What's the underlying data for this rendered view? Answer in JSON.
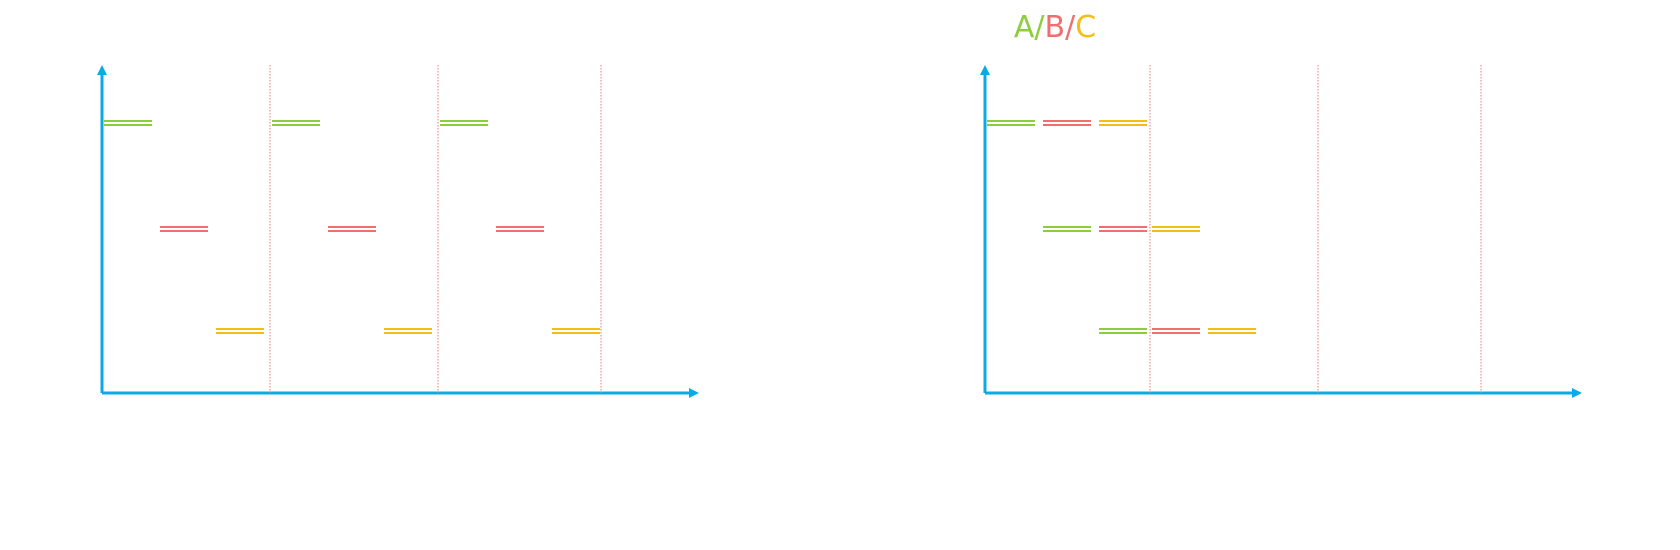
{
  "colors": {
    "axis": "#0AAAE6",
    "divider": "#F07878",
    "A": "#8CCD3C",
    "B": "#F06E6E",
    "C": "#F5BE14",
    "background": "#FFFFFF"
  },
  "legend": {
    "parts": [
      {
        "text": "A",
        "color_key": "A"
      },
      {
        "text": "/",
        "color_key": "A"
      },
      {
        "text": "B",
        "color_key": "B"
      },
      {
        "text": "/",
        "color_key": "B"
      },
      {
        "text": "C",
        "color_key": "C"
      }
    ]
  },
  "diagrams": [
    {
      "id": "sequential",
      "rows": [
        "A",
        "B",
        "C"
      ],
      "periods": 3,
      "slots_per_period": 3,
      "segments": [
        {
          "row": 0,
          "period": 0,
          "slot": 0,
          "color_key": "A"
        },
        {
          "row": 1,
          "period": 0,
          "slot": 1,
          "color_key": "B"
        },
        {
          "row": 2,
          "period": 0,
          "slot": 2,
          "color_key": "C"
        },
        {
          "row": 0,
          "period": 1,
          "slot": 0,
          "color_key": "A"
        },
        {
          "row": 1,
          "period": 1,
          "slot": 1,
          "color_key": "B"
        },
        {
          "row": 2,
          "period": 1,
          "slot": 2,
          "color_key": "C"
        },
        {
          "row": 0,
          "period": 2,
          "slot": 0,
          "color_key": "A"
        },
        {
          "row": 1,
          "period": 2,
          "slot": 1,
          "color_key": "B"
        },
        {
          "row": 2,
          "period": 2,
          "slot": 2,
          "color_key": "C"
        }
      ]
    },
    {
      "id": "pipelined",
      "rows": [
        "A",
        "B",
        "C"
      ],
      "periods": 3,
      "slots_per_period": 3,
      "segments": [
        {
          "row": 0,
          "period": 0,
          "slot": 0,
          "color_key": "A"
        },
        {
          "row": 0,
          "period": 0,
          "slot": 1,
          "color_key": "B"
        },
        {
          "row": 0,
          "period": 0,
          "slot": 2,
          "color_key": "C"
        },
        {
          "row": 1,
          "period": 0,
          "slot": 1,
          "color_key": "A"
        },
        {
          "row": 1,
          "period": 0,
          "slot": 2,
          "color_key": "B"
        },
        {
          "row": 1,
          "period": 1,
          "slot": 0,
          "color_key": "C"
        },
        {
          "row": 2,
          "period": 0,
          "slot": 2,
          "color_key": "A"
        },
        {
          "row": 2,
          "period": 1,
          "slot": 0,
          "color_key": "B"
        },
        {
          "row": 2,
          "period": 1,
          "slot": 1,
          "color_key": "C"
        }
      ]
    }
  ]
}
